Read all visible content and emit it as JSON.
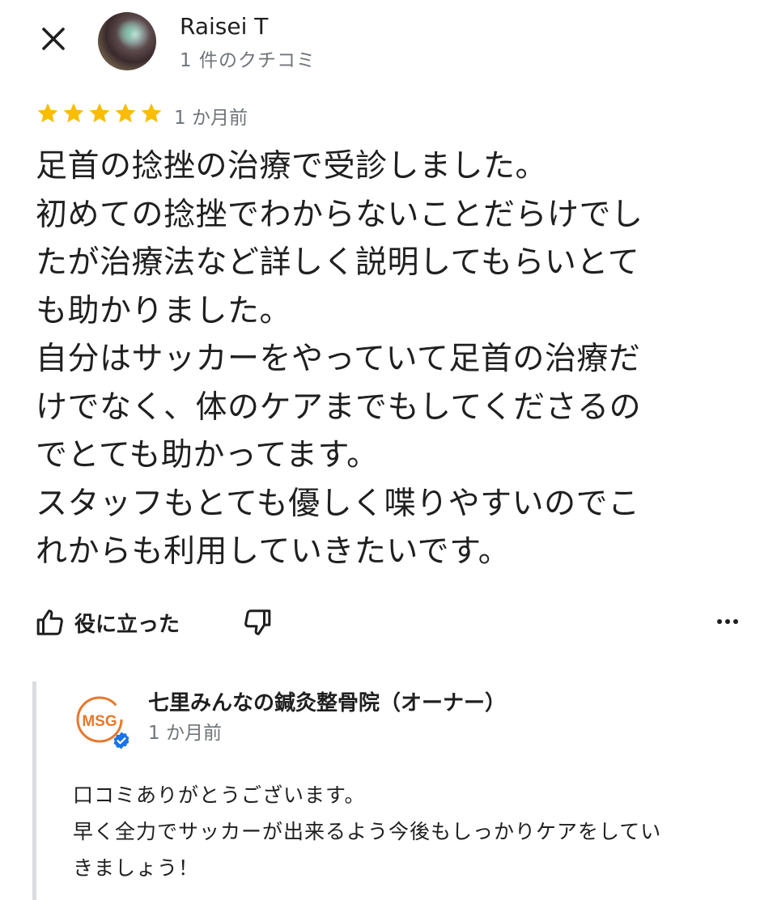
{
  "reviewer": {
    "name": "Raisei T",
    "review_count": "1 件のクチコミ"
  },
  "review": {
    "rating": 5,
    "max_rating": 5,
    "date": "1 か月前",
    "text": "足首の捻挫の治療で受診しました。\n初めての捻挫でわからないことだらけでし\nたが治療法など詳しく説明してもらいとて\nも助かりました。\n自分はサッカーをやっていて足首の治療だ\nけでなく、体のケアまでもしてくださるの\nでとても助かってます。\nスタッフもとても優しく喋りやすいのでこ\nれからも利用していきたいです。"
  },
  "actions": {
    "helpful_label": "役に立った"
  },
  "owner_reply": {
    "name": "七里みんなの鍼灸整骨院（オーナー）",
    "date": "1 か月前",
    "logo_text": "MSG",
    "text": "口コミありがとうございます。\n早く全力でサッカーが出来るよう今後もしっかりケアをしてい\nきましょう！"
  },
  "colors": {
    "star": "#fbbc04",
    "secondary_text": "#70757a",
    "verified": "#1a73e8",
    "logo_orange": "#e8782c"
  },
  "icons": [
    "close-icon",
    "star-icon",
    "thumb-up-icon",
    "thumb-down-icon",
    "more-horizontal-icon",
    "verified-badge-icon"
  ]
}
